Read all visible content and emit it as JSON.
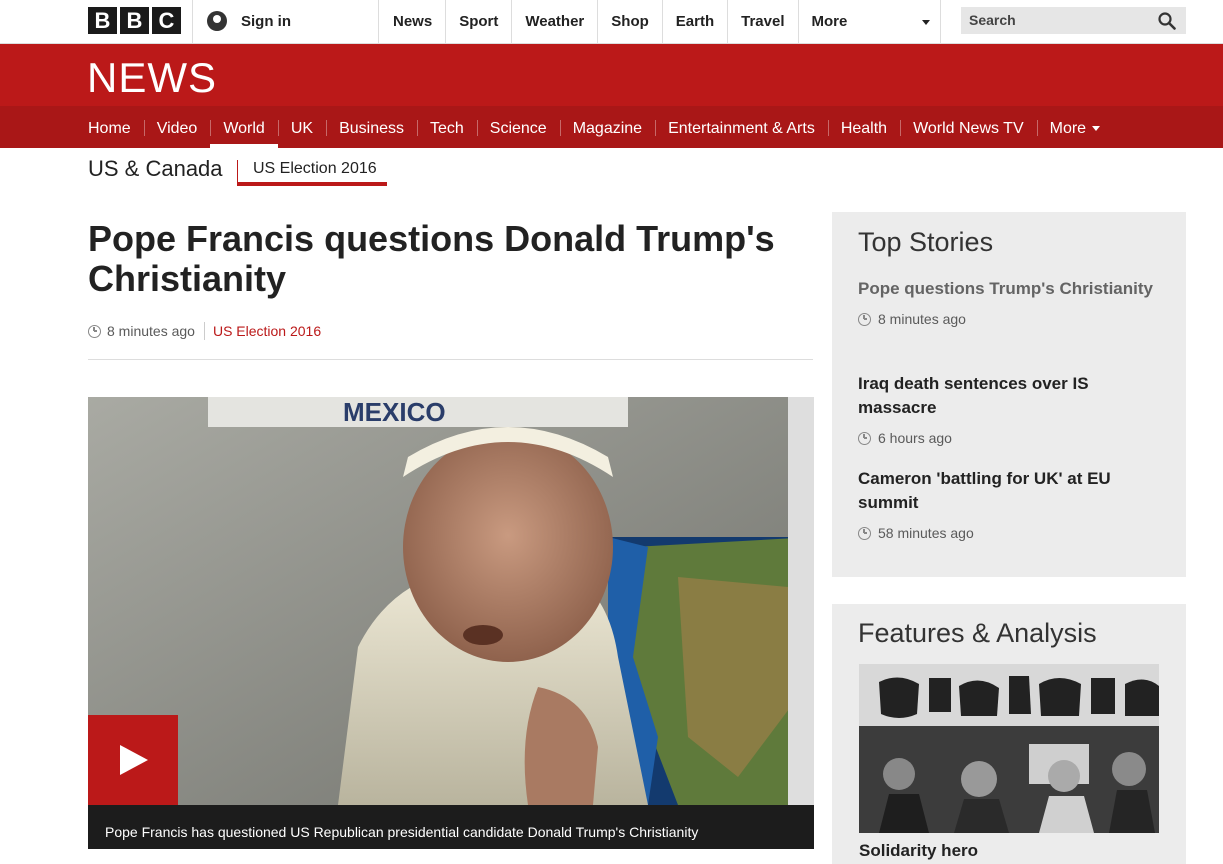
{
  "topbar": {
    "logo_letters": [
      "B",
      "B",
      "C"
    ],
    "signin_label": "Sign in",
    "nav": [
      "News",
      "Sport",
      "Weather",
      "Shop",
      "Earth",
      "Travel"
    ],
    "more_label": "More",
    "search_placeholder": "Search"
  },
  "news": {
    "logo": "NEWS",
    "nav": [
      {
        "label": "Home"
      },
      {
        "label": "Video"
      },
      {
        "label": "World",
        "active": true
      },
      {
        "label": "UK"
      },
      {
        "label": "Business"
      },
      {
        "label": "Tech"
      },
      {
        "label": "Science"
      },
      {
        "label": "Magazine"
      },
      {
        "label": "Entertainment & Arts"
      },
      {
        "label": "Health"
      },
      {
        "label": "World News TV"
      }
    ],
    "more_label": "More"
  },
  "section": {
    "name": "US & Canada",
    "sub": "US Election 2016"
  },
  "article": {
    "headline": "Pope Francis questions Donald Trump's Christianity",
    "time": "8 minutes ago",
    "topic": "US Election 2016",
    "video_caption": "Pope Francis has questioned US Republican presidential candidate Donald Trump's Christianity"
  },
  "top_stories": {
    "title": "Top Stories",
    "items": [
      {
        "title": "Pope questions Trump's Christianity",
        "time": "8 minutes ago",
        "visited": true
      },
      {
        "title": "Iraq death sentences over IS massacre",
        "time": "6 hours ago",
        "visited": false
      },
      {
        "title": "Cameron 'battling for UK' at EU summit",
        "time": "58 minutes ago",
        "visited": false
      }
    ]
  },
  "features": {
    "title": "Features & Analysis",
    "item_title": "Solidarity hero"
  },
  "colors": {
    "bbc_red": "#bb1919",
    "nav_red": "#a91717",
    "panel_grey": "#ececec"
  }
}
